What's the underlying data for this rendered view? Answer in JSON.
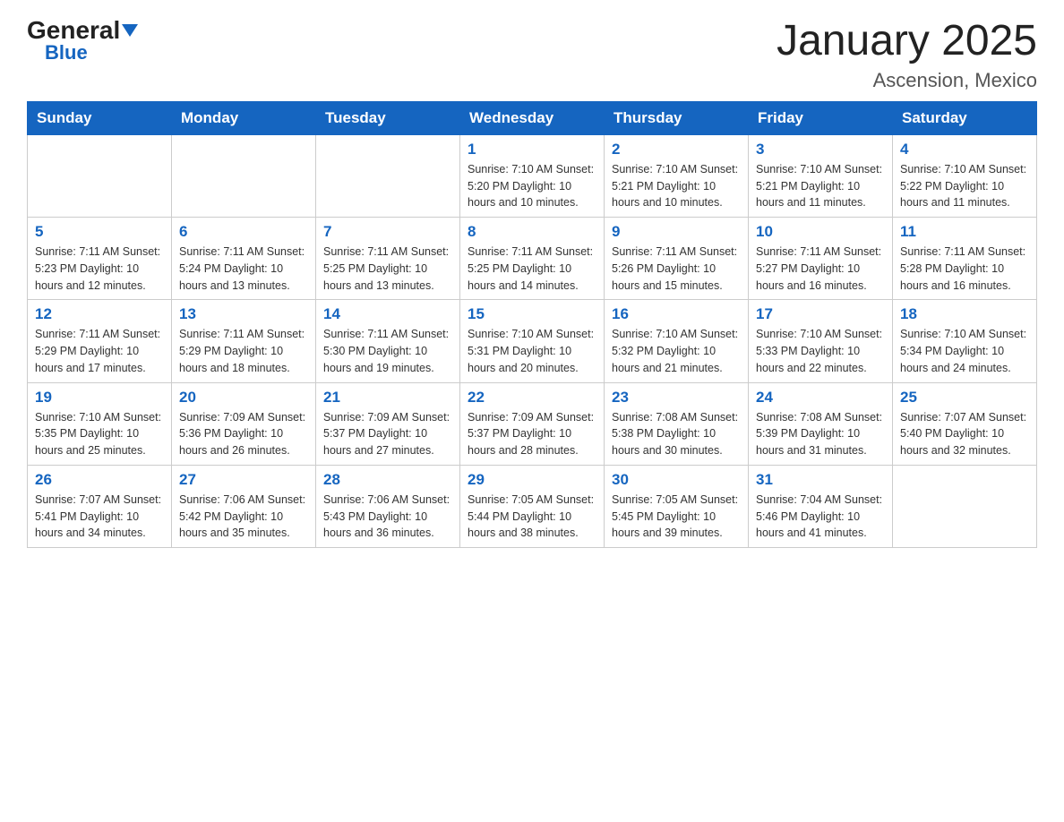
{
  "logo": {
    "general": "General",
    "triangle": "▼",
    "blue": "Blue"
  },
  "title": "January 2025",
  "subtitle": "Ascension, Mexico",
  "days_of_week": [
    "Sunday",
    "Monday",
    "Tuesday",
    "Wednesday",
    "Thursday",
    "Friday",
    "Saturday"
  ],
  "weeks": [
    [
      {
        "day": "",
        "info": ""
      },
      {
        "day": "",
        "info": ""
      },
      {
        "day": "",
        "info": ""
      },
      {
        "day": "1",
        "info": "Sunrise: 7:10 AM\nSunset: 5:20 PM\nDaylight: 10 hours\nand 10 minutes."
      },
      {
        "day": "2",
        "info": "Sunrise: 7:10 AM\nSunset: 5:21 PM\nDaylight: 10 hours\nand 10 minutes."
      },
      {
        "day": "3",
        "info": "Sunrise: 7:10 AM\nSunset: 5:21 PM\nDaylight: 10 hours\nand 11 minutes."
      },
      {
        "day": "4",
        "info": "Sunrise: 7:10 AM\nSunset: 5:22 PM\nDaylight: 10 hours\nand 11 minutes."
      }
    ],
    [
      {
        "day": "5",
        "info": "Sunrise: 7:11 AM\nSunset: 5:23 PM\nDaylight: 10 hours\nand 12 minutes."
      },
      {
        "day": "6",
        "info": "Sunrise: 7:11 AM\nSunset: 5:24 PM\nDaylight: 10 hours\nand 13 minutes."
      },
      {
        "day": "7",
        "info": "Sunrise: 7:11 AM\nSunset: 5:25 PM\nDaylight: 10 hours\nand 13 minutes."
      },
      {
        "day": "8",
        "info": "Sunrise: 7:11 AM\nSunset: 5:25 PM\nDaylight: 10 hours\nand 14 minutes."
      },
      {
        "day": "9",
        "info": "Sunrise: 7:11 AM\nSunset: 5:26 PM\nDaylight: 10 hours\nand 15 minutes."
      },
      {
        "day": "10",
        "info": "Sunrise: 7:11 AM\nSunset: 5:27 PM\nDaylight: 10 hours\nand 16 minutes."
      },
      {
        "day": "11",
        "info": "Sunrise: 7:11 AM\nSunset: 5:28 PM\nDaylight: 10 hours\nand 16 minutes."
      }
    ],
    [
      {
        "day": "12",
        "info": "Sunrise: 7:11 AM\nSunset: 5:29 PM\nDaylight: 10 hours\nand 17 minutes."
      },
      {
        "day": "13",
        "info": "Sunrise: 7:11 AM\nSunset: 5:29 PM\nDaylight: 10 hours\nand 18 minutes."
      },
      {
        "day": "14",
        "info": "Sunrise: 7:11 AM\nSunset: 5:30 PM\nDaylight: 10 hours\nand 19 minutes."
      },
      {
        "day": "15",
        "info": "Sunrise: 7:10 AM\nSunset: 5:31 PM\nDaylight: 10 hours\nand 20 minutes."
      },
      {
        "day": "16",
        "info": "Sunrise: 7:10 AM\nSunset: 5:32 PM\nDaylight: 10 hours\nand 21 minutes."
      },
      {
        "day": "17",
        "info": "Sunrise: 7:10 AM\nSunset: 5:33 PM\nDaylight: 10 hours\nand 22 minutes."
      },
      {
        "day": "18",
        "info": "Sunrise: 7:10 AM\nSunset: 5:34 PM\nDaylight: 10 hours\nand 24 minutes."
      }
    ],
    [
      {
        "day": "19",
        "info": "Sunrise: 7:10 AM\nSunset: 5:35 PM\nDaylight: 10 hours\nand 25 minutes."
      },
      {
        "day": "20",
        "info": "Sunrise: 7:09 AM\nSunset: 5:36 PM\nDaylight: 10 hours\nand 26 minutes."
      },
      {
        "day": "21",
        "info": "Sunrise: 7:09 AM\nSunset: 5:37 PM\nDaylight: 10 hours\nand 27 minutes."
      },
      {
        "day": "22",
        "info": "Sunrise: 7:09 AM\nSunset: 5:37 PM\nDaylight: 10 hours\nand 28 minutes."
      },
      {
        "day": "23",
        "info": "Sunrise: 7:08 AM\nSunset: 5:38 PM\nDaylight: 10 hours\nand 30 minutes."
      },
      {
        "day": "24",
        "info": "Sunrise: 7:08 AM\nSunset: 5:39 PM\nDaylight: 10 hours\nand 31 minutes."
      },
      {
        "day": "25",
        "info": "Sunrise: 7:07 AM\nSunset: 5:40 PM\nDaylight: 10 hours\nand 32 minutes."
      }
    ],
    [
      {
        "day": "26",
        "info": "Sunrise: 7:07 AM\nSunset: 5:41 PM\nDaylight: 10 hours\nand 34 minutes."
      },
      {
        "day": "27",
        "info": "Sunrise: 7:06 AM\nSunset: 5:42 PM\nDaylight: 10 hours\nand 35 minutes."
      },
      {
        "day": "28",
        "info": "Sunrise: 7:06 AM\nSunset: 5:43 PM\nDaylight: 10 hours\nand 36 minutes."
      },
      {
        "day": "29",
        "info": "Sunrise: 7:05 AM\nSunset: 5:44 PM\nDaylight: 10 hours\nand 38 minutes."
      },
      {
        "day": "30",
        "info": "Sunrise: 7:05 AM\nSunset: 5:45 PM\nDaylight: 10 hours\nand 39 minutes."
      },
      {
        "day": "31",
        "info": "Sunrise: 7:04 AM\nSunset: 5:46 PM\nDaylight: 10 hours\nand 41 minutes."
      },
      {
        "day": "",
        "info": ""
      }
    ]
  ]
}
